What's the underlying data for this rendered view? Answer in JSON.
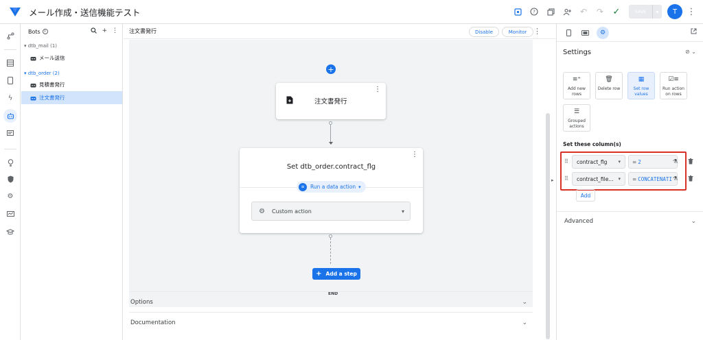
{
  "header": {
    "title": "メール作成・送信機能テスト",
    "save_label": "SAVE",
    "avatar_initial": "T",
    "icons": [
      "preview-icon",
      "help-icon",
      "copy-icon",
      "share-icon",
      "undo-icon",
      "redo-icon",
      "check-icon",
      "more-vert-icon"
    ]
  },
  "rail": {
    "icons": [
      "flow-icon",
      "table-icon",
      "mobile-icon",
      "bolt-icon",
      "bot-icon",
      "chat-icon",
      "lightbulb-icon",
      "shield-icon",
      "gear-icon",
      "monitor-icon",
      "school-icon"
    ]
  },
  "bots_panel": {
    "title": "Bots",
    "groups": [
      {
        "label": "dtb_mail (1)",
        "items": [
          {
            "label": "メール送信"
          }
        ]
      },
      {
        "label": "dtb_order (2)",
        "items": [
          {
            "label": "見積書発行"
          },
          {
            "label": "注文書発行"
          }
        ]
      }
    ]
  },
  "center": {
    "title": "注文書発行",
    "disable_label": "Disable",
    "monitor_label": "Monitor",
    "event_card": {
      "label": "注文書発行"
    },
    "action_card": {
      "title": "Set dtb_order.contract_flg",
      "run_label": "Run a data action",
      "select_value": "Custom action"
    },
    "add_step_label": "Add a step",
    "end_label": "END",
    "sections": [
      {
        "label": "Options"
      },
      {
        "label": "Documentation"
      }
    ]
  },
  "settings": {
    "title": "Settings",
    "tiles": [
      {
        "label": "Add new rows",
        "icon": "add-rows-icon"
      },
      {
        "label": "Delete row",
        "icon": "delete-icon"
      },
      {
        "label": "Set row values",
        "icon": "table-edit-icon",
        "active": true
      },
      {
        "label": "Run action on rows",
        "icon": "checklist-icon"
      },
      {
        "label": "Grouped actions",
        "icon": "list-icon"
      }
    ],
    "set_columns_label": "Set these column(s)",
    "columns": [
      {
        "column": "contract_flg",
        "expression": "2"
      },
      {
        "column": "contract_file...",
        "expression": "CONCATENATI"
      }
    ],
    "add_label": "Add",
    "advanced_label": "Advanced"
  },
  "colors": {
    "accent": "#1a73e8",
    "highlight": "#d93025",
    "selected_bg": "#d2e3fc"
  }
}
